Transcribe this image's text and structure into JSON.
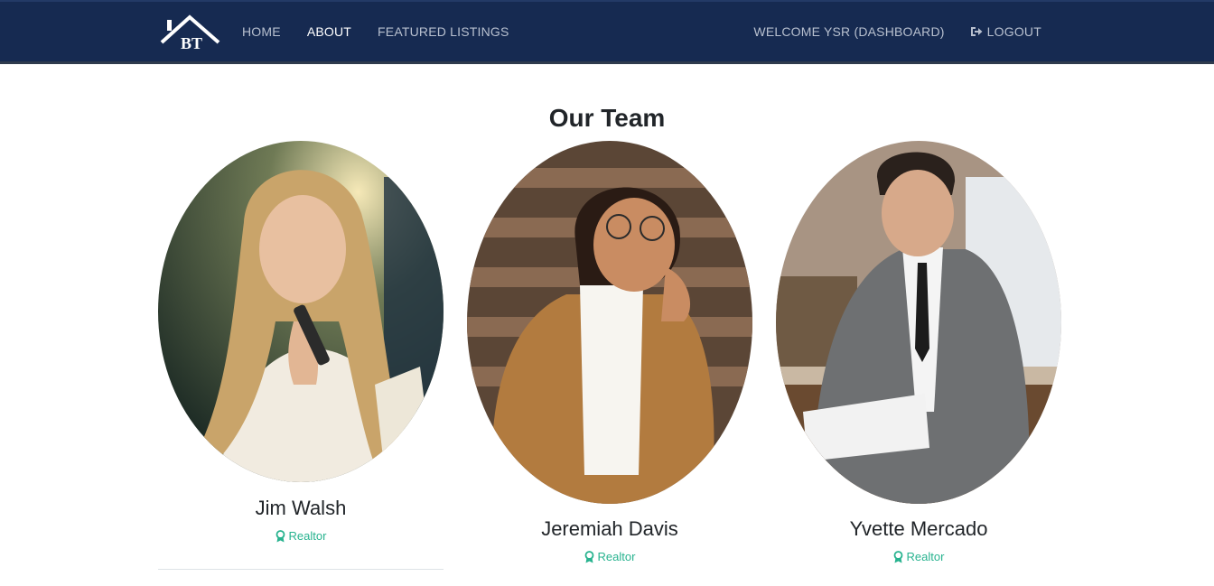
{
  "nav": {
    "brand_text": "BT",
    "links": [
      {
        "label": "HOME",
        "active": false
      },
      {
        "label": "ABOUT",
        "active": true
      },
      {
        "label": "FEATURED LISTINGS",
        "active": false
      }
    ],
    "welcome_label": "WELCOME YSR (DASHBOARD)",
    "logout_label": "LOGOUT",
    "logout_icon": "sign-out-icon"
  },
  "team": {
    "title": "Our Team",
    "members": [
      {
        "name": "Jim Walsh",
        "role": "Realtor",
        "role_icon": "award-icon"
      },
      {
        "name": "Jeremiah Davis",
        "role": "Realtor",
        "role_icon": "award-icon"
      },
      {
        "name": "Yvette Mercado",
        "role": "Realtor",
        "role_icon": "award-icon"
      }
    ]
  },
  "colors": {
    "navbar_bg": "#162a51",
    "nav_text": "#b8c0cf",
    "nav_active": "#ffffff",
    "accent_green": "#28b38f",
    "heading_text": "#212529"
  }
}
